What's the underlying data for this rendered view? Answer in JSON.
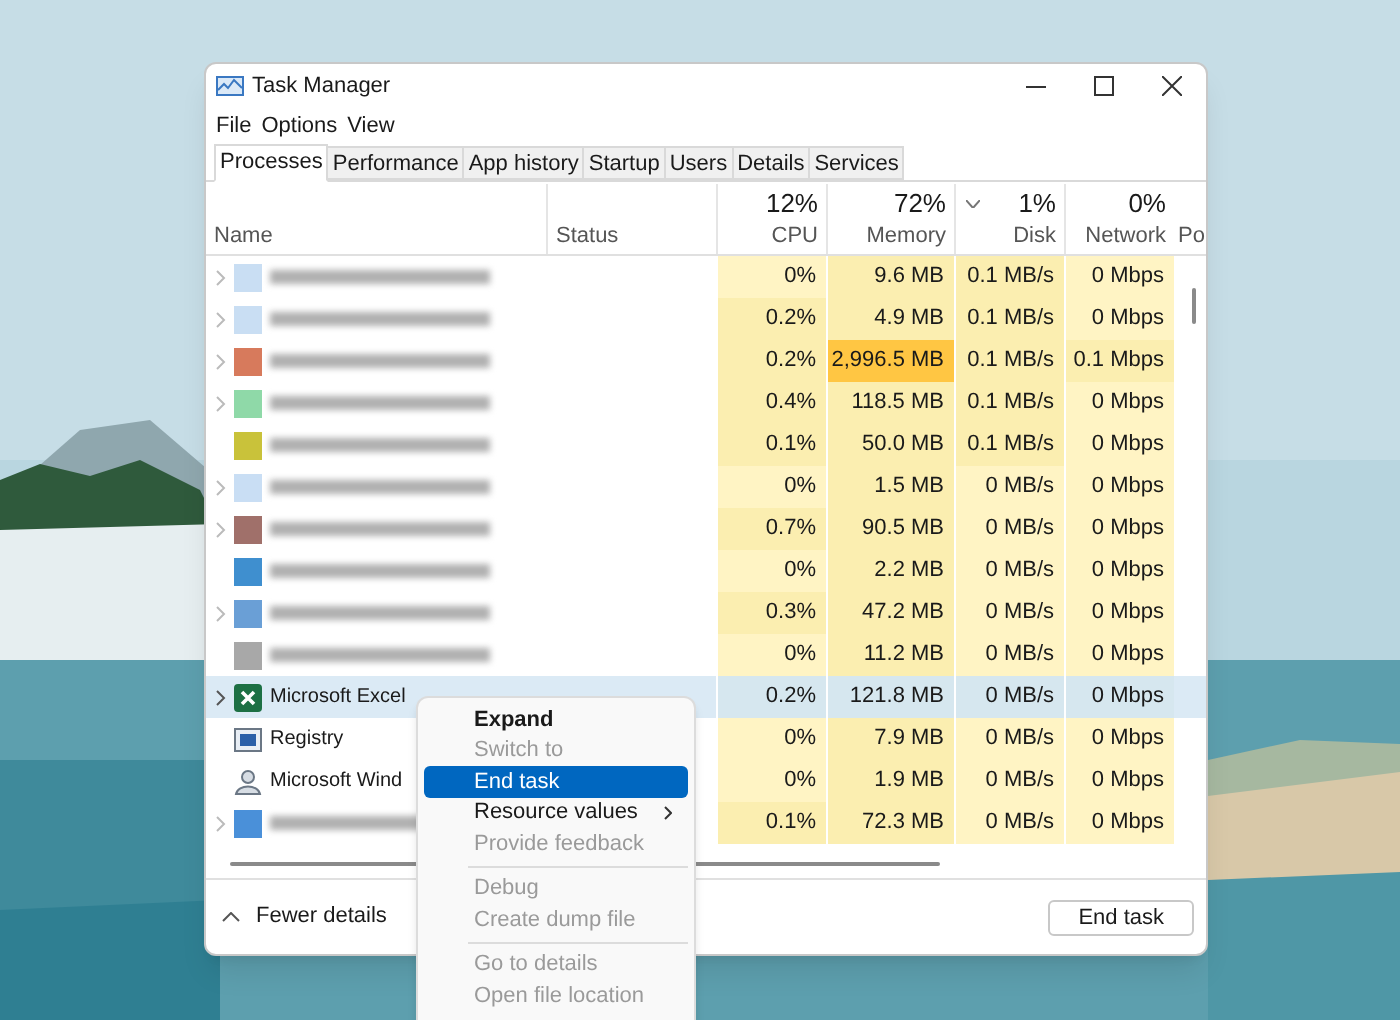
{
  "window": {
    "title": "Task Manager"
  },
  "menu": [
    "File",
    "Options",
    "View"
  ],
  "tabs": [
    {
      "label": "Processes",
      "selected": true
    },
    {
      "label": "Performance",
      "selected": false
    },
    {
      "label": "App history",
      "selected": false
    },
    {
      "label": "Startup",
      "selected": false
    },
    {
      "label": "Users",
      "selected": false
    },
    {
      "label": "Details",
      "selected": false
    },
    {
      "label": "Services",
      "selected": false
    }
  ],
  "columns": [
    {
      "kind": "text",
      "label": "Name"
    },
    {
      "kind": "text",
      "label": "Status"
    },
    {
      "kind": "metric",
      "total": "12%",
      "label": "CPU",
      "sorted": false
    },
    {
      "kind": "metric",
      "total": "72%",
      "label": "Memory",
      "sorted": false
    },
    {
      "kind": "metric",
      "total": "1%",
      "label": "Disk",
      "sorted": true
    },
    {
      "kind": "metric",
      "total": "0%",
      "label": "Network",
      "sorted": false
    },
    {
      "kind": "text",
      "label": "Po"
    }
  ],
  "rows": [
    {
      "kind": "blurred",
      "expandable": true,
      "selected": false,
      "color": "#c9def3",
      "values": [
        {
          "text": "0%",
          "color": "#fff4c4"
        },
        {
          "text": "9.6 MB",
          "color": "#fbeeb0"
        },
        {
          "text": "0.1 MB/s",
          "color": "#fbeeb0"
        },
        {
          "text": "0 Mbps",
          "color": "#fff4c4"
        }
      ]
    },
    {
      "kind": "blurred",
      "expandable": true,
      "selected": false,
      "color": "#c9def3",
      "values": [
        {
          "text": "0.2%",
          "color": "#fbeeb0"
        },
        {
          "text": "4.9 MB",
          "color": "#fbeeb0"
        },
        {
          "text": "0.1 MB/s",
          "color": "#fbeeb0"
        },
        {
          "text": "0 Mbps",
          "color": "#fff4c4"
        }
      ]
    },
    {
      "kind": "blurred",
      "expandable": true,
      "selected": false,
      "color": "#d77a5c",
      "values": [
        {
          "text": "0.2%",
          "color": "#fbeeb0"
        },
        {
          "text": "2,996.5 MB",
          "color": "#ffc643"
        },
        {
          "text": "0.1 MB/s",
          "color": "#fbeeb0"
        },
        {
          "text": "0.1 Mbps",
          "color": "#fbeeb0"
        }
      ]
    },
    {
      "kind": "blurred",
      "expandable": true,
      "selected": false,
      "color": "#8fd9a8",
      "values": [
        {
          "text": "0.4%",
          "color": "#fbeeb0"
        },
        {
          "text": "118.5 MB",
          "color": "#fbeeb0"
        },
        {
          "text": "0.1 MB/s",
          "color": "#fbeeb0"
        },
        {
          "text": "0 Mbps",
          "color": "#fff4c4"
        }
      ]
    },
    {
      "kind": "blurred",
      "expandable": false,
      "selected": false,
      "color": "#c9c23a",
      "values": [
        {
          "text": "0.1%",
          "color": "#fbeeb0"
        },
        {
          "text": "50.0 MB",
          "color": "#fbeeb0"
        },
        {
          "text": "0.1 MB/s",
          "color": "#fbeeb0"
        },
        {
          "text": "0 Mbps",
          "color": "#fff4c4"
        }
      ]
    },
    {
      "kind": "blurred",
      "expandable": true,
      "selected": false,
      "color": "#c9def4",
      "values": [
        {
          "text": "0%",
          "color": "#fff4c4"
        },
        {
          "text": "1.5 MB",
          "color": "#fbeeb0"
        },
        {
          "text": "0 MB/s",
          "color": "#fff4c4"
        },
        {
          "text": "0 Mbps",
          "color": "#fff4c4"
        }
      ]
    },
    {
      "kind": "blurred",
      "expandable": true,
      "selected": false,
      "color": "#a0706a",
      "values": [
        {
          "text": "0.7%",
          "color": "#fbeeb0"
        },
        {
          "text": "90.5 MB",
          "color": "#fbeeb0"
        },
        {
          "text": "0 MB/s",
          "color": "#fff4c4"
        },
        {
          "text": "0 Mbps",
          "color": "#fff4c4"
        }
      ]
    },
    {
      "kind": "blurred",
      "expandable": false,
      "selected": false,
      "color": "#3f8fcf",
      "values": [
        {
          "text": "0%",
          "color": "#fff4c4"
        },
        {
          "text": "2.2 MB",
          "color": "#fbeeb0"
        },
        {
          "text": "0 MB/s",
          "color": "#fff4c4"
        },
        {
          "text": "0 Mbps",
          "color": "#fff4c4"
        }
      ]
    },
    {
      "kind": "blurred",
      "expandable": true,
      "selected": false,
      "color": "#6a9fd6",
      "values": [
        {
          "text": "0.3%",
          "color": "#fbeeb0"
        },
        {
          "text": "47.2 MB",
          "color": "#fbeeb0"
        },
        {
          "text": "0 MB/s",
          "color": "#fff4c4"
        },
        {
          "text": "0 Mbps",
          "color": "#fff4c4"
        }
      ]
    },
    {
      "kind": "blurred",
      "expandable": false,
      "selected": false,
      "color": "#a8a8a8",
      "values": [
        {
          "text": "0%",
          "color": "#fff4c4"
        },
        {
          "text": "11.2 MB",
          "color": "#fbeeb0"
        },
        {
          "text": "0 MB/s",
          "color": "#fff4c4"
        },
        {
          "text": "0 Mbps",
          "color": "#fff4c4"
        }
      ]
    },
    {
      "kind": "excel",
      "name": "Microsoft Excel",
      "expandable": true,
      "selected": true,
      "values": [
        {
          "text": "0.2%",
          "color": "#d6e7ef"
        },
        {
          "text": "121.8 MB",
          "color": "#d6e7ef"
        },
        {
          "text": "0 MB/s",
          "color": "#d6e7ef"
        },
        {
          "text": "0 Mbps",
          "color": "#d6e7ef"
        }
      ]
    },
    {
      "kind": "registry",
      "name": "Registry",
      "expandable": false,
      "selected": false,
      "values": [
        {
          "text": "0%",
          "color": "#fff4c4"
        },
        {
          "text": "7.9 MB",
          "color": "#fbeeb0"
        },
        {
          "text": "0 MB/s",
          "color": "#fff4c4"
        },
        {
          "text": "0 Mbps",
          "color": "#fff4c4"
        }
      ]
    },
    {
      "kind": "user",
      "name": "Microsoft Wind",
      "expandable": false,
      "selected": false,
      "values": [
        {
          "text": "0%",
          "color": "#fff4c4"
        },
        {
          "text": "1.9 MB",
          "color": "#fbeeb0"
        },
        {
          "text": "0 MB/s",
          "color": "#fff4c4"
        },
        {
          "text": "0 Mbps",
          "color": "#fff4c4"
        }
      ]
    },
    {
      "kind": "blurred",
      "expandable": true,
      "selected": false,
      "color": "#4a90d9",
      "values": [
        {
          "text": "0.1%",
          "color": "#fbeeb0"
        },
        {
          "text": "72.3 MB",
          "color": "#fbeeb0"
        },
        {
          "text": "0 MB/s",
          "color": "#fff4c4"
        },
        {
          "text": "0 Mbps",
          "color": "#fff4c4"
        }
      ]
    }
  ],
  "footer": {
    "toggle": "Fewer details",
    "button": "End task"
  },
  "context_menu": [
    {
      "kind": "item",
      "label": "Expand",
      "bold": true,
      "disabled": false,
      "selected": false
    },
    {
      "kind": "item",
      "label": "Switch to",
      "bold": false,
      "disabled": true,
      "selected": false
    },
    {
      "kind": "item",
      "label": "End task",
      "bold": false,
      "disabled": false,
      "selected": true
    },
    {
      "kind": "submenu",
      "label": "Resource values",
      "bold": false,
      "disabled": false,
      "selected": false
    },
    {
      "kind": "item",
      "label": "Provide feedback",
      "bold": false,
      "disabled": true,
      "selected": false
    },
    {
      "kind": "separator"
    },
    {
      "kind": "item",
      "label": "Debug",
      "bold": false,
      "disabled": true,
      "selected": false
    },
    {
      "kind": "item",
      "label": "Create dump file",
      "bold": false,
      "disabled": true,
      "selected": false
    },
    {
      "kind": "separator"
    },
    {
      "kind": "item",
      "label": "Go to details",
      "bold": false,
      "disabled": true,
      "selected": false
    },
    {
      "kind": "item",
      "label": "Open file location",
      "bold": false,
      "disabled": true,
      "selected": false
    }
  ]
}
